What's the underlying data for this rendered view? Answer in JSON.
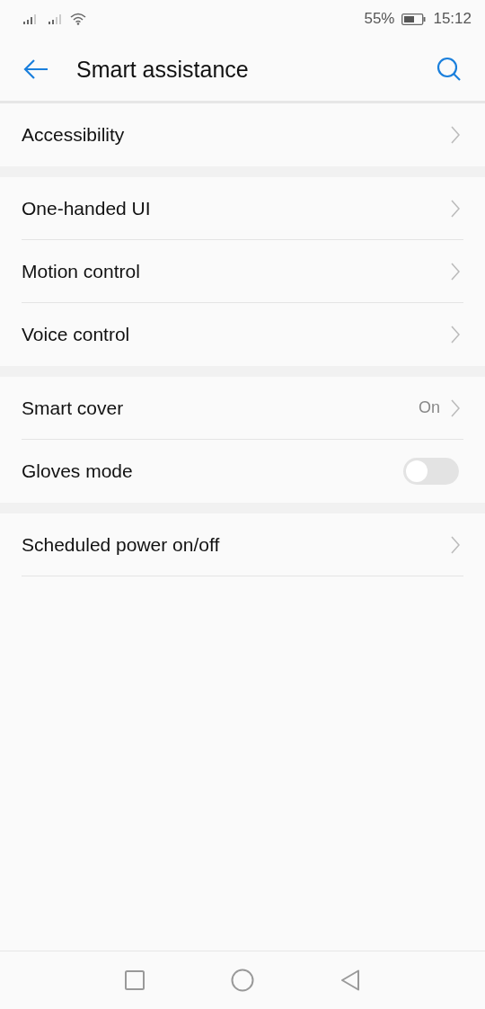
{
  "status_bar": {
    "battery_percent": "55%",
    "time": "15:12"
  },
  "toolbar": {
    "title": "Smart assistance"
  },
  "sections": [
    {
      "items": [
        {
          "kind": "link",
          "label": "Accessibility"
        }
      ]
    },
    {
      "items": [
        {
          "kind": "link",
          "label": "One-handed UI"
        },
        {
          "kind": "link",
          "label": "Motion control"
        },
        {
          "kind": "link",
          "label": "Voice control"
        }
      ]
    },
    {
      "items": [
        {
          "kind": "link",
          "label": "Smart cover",
          "value": "On"
        },
        {
          "kind": "toggle",
          "label": "Gloves mode",
          "on": false
        }
      ]
    },
    {
      "items": [
        {
          "kind": "link",
          "label": "Scheduled power on/off"
        }
      ]
    }
  ]
}
